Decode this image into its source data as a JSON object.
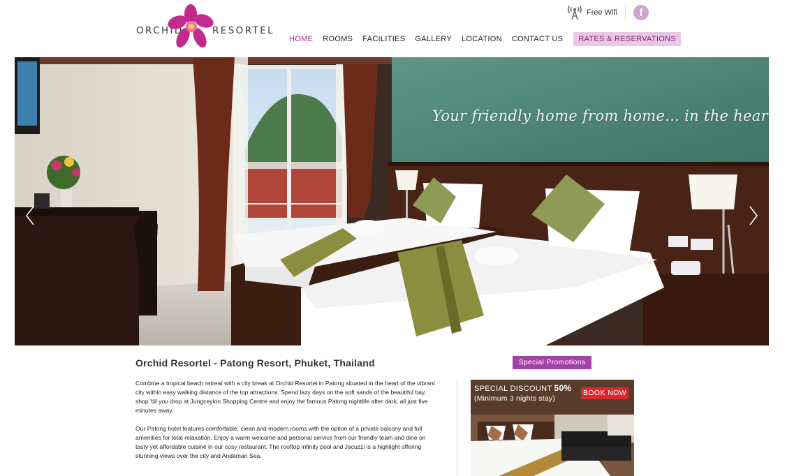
{
  "header": {
    "logo_left": "ORCHID",
    "logo_right": "RESORTEL",
    "wifi_label": "Free Wifi",
    "facebook_glyph": "f"
  },
  "nav": {
    "items": [
      {
        "label": "HOME",
        "active": true
      },
      {
        "label": "ROOMS",
        "active": false
      },
      {
        "label": "FACILITIES",
        "active": false
      },
      {
        "label": "GALLERY",
        "active": false
      },
      {
        "label": "LOCATION",
        "active": false
      },
      {
        "label": "CONTACT US",
        "active": false
      }
    ],
    "cta_label": "RATES & RESERVATIONS"
  },
  "hero": {
    "tagline": "Your friendly home from home... in the heart of patong"
  },
  "content": {
    "title": "Orchid Resortel - Patong Resort, Phuket, Thailand",
    "paragraphs": [
      "Combine a tropical beach retreat with a city break at Orchid Resortel in Patong situated in the heart of the vibrant city within easy walking distance of the top attractions. Spend lazy days on the soft sands of the beautiful bay, shop 'till you drop at Jungceylon Shopping Centre and enjoy the famous Patong nightlife after dark, all just five minutes away.",
      "Our Patong hotel features comfortable, clean and modern rooms with the option of a private balcony and full amenities for total relaxation. Enjoy a warm welcome and personal service from our friendly team and dine on tasty yet affordable cuisine in our cosy restaurant. The rooftop infinity pool and Jacuzzi is a highlight offering stunning views over the city and Andaman Sea."
    ]
  },
  "promo": {
    "badge": "Special Promotions",
    "discount_label": "SPECIAL DISCOUNT",
    "discount_value": "50%",
    "minimum_note": "(Minimum 3 nights stay)",
    "book_now": "BOOK NOW"
  },
  "colors": {
    "accent": "#a440a6",
    "nav_active": "#a8278f",
    "cta_bg": "#e8c8e6",
    "book_now": "#e0262c"
  }
}
